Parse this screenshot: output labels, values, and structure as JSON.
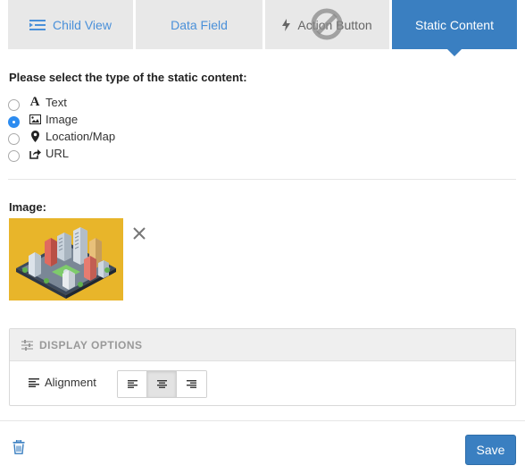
{
  "tabs": [
    {
      "label": "Child View",
      "icon": "child-view-icon",
      "state": "inactive"
    },
    {
      "label": "Data Field",
      "icon": "",
      "state": "inactive"
    },
    {
      "label": "Action Button",
      "icon": "lightning-icon",
      "state": "disabled"
    },
    {
      "label": "Static Content",
      "icon": "",
      "state": "active"
    }
  ],
  "content_type": {
    "prompt": "Please select the type of the static content:",
    "options": [
      {
        "label": "Text",
        "icon": "text-icon",
        "selected": false
      },
      {
        "label": "Image",
        "icon": "image-icon",
        "selected": true
      },
      {
        "label": "Location/Map",
        "icon": "map-marker-icon",
        "selected": false
      },
      {
        "label": "URL",
        "icon": "external-link-icon",
        "selected": false
      }
    ]
  },
  "image": {
    "label": "Image:",
    "thumbnail": "isometric-city-image"
  },
  "display_options": {
    "title": "DISPLAY OPTIONS",
    "alignment_label": "Alignment",
    "alignment_options": [
      "left",
      "center",
      "right"
    ],
    "alignment_selected": "center"
  },
  "footer": {
    "save_label": "Save"
  },
  "colors": {
    "primary": "#3a7fc1",
    "tab_inactive_bg": "#e8e8e8",
    "tab_link": "#4a90d9",
    "image_bg": "#e8b52a",
    "radio_selected": "#2d8cf0"
  }
}
